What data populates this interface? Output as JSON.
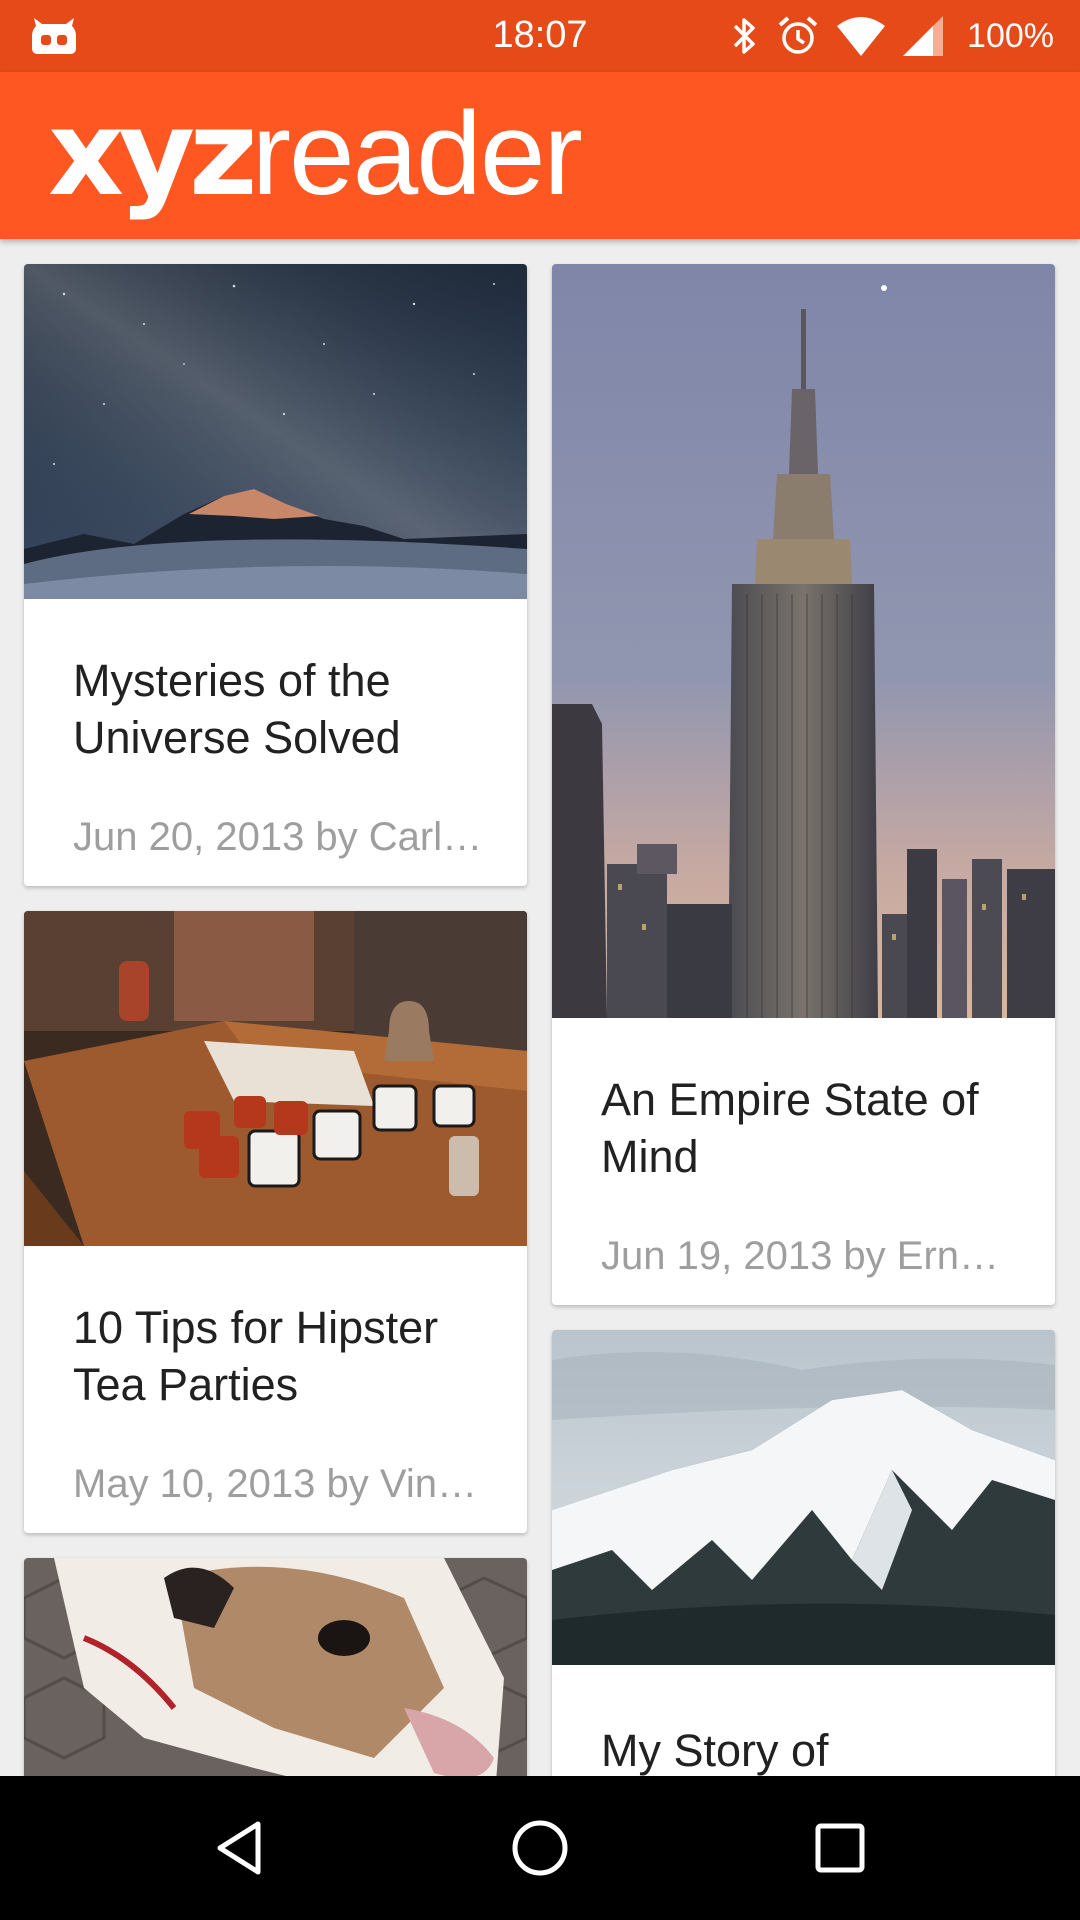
{
  "status_bar": {
    "time": "18:07",
    "battery": "100%",
    "icons": [
      "app-icon",
      "bluetooth-icon",
      "alarm-icon",
      "wifi-icon",
      "signal-icon"
    ]
  },
  "app_bar": {
    "logo_bold": "xyz",
    "logo_light": "reader",
    "background": "#ff5722"
  },
  "articles": [
    {
      "title": "Mysteries of the Universe Solved",
      "meta": "Jun 20, 2013 by Carl…",
      "image": "night-sky-mountains"
    },
    {
      "title": "An Empire State of Mind",
      "meta": "Jun 19, 2013 by Ern…",
      "image": "empire-state-building"
    },
    {
      "title": "10 Tips for Hipster Tea Parties",
      "meta": "May 10, 2013 by Vin…",
      "image": "tea-cups-table"
    },
    {
      "title": "My Story of",
      "meta": "",
      "image": "snowy-mountain"
    },
    {
      "title": "",
      "meta": "",
      "image": "bulldog"
    }
  ],
  "nav_bar": {
    "icons": [
      "back-icon",
      "home-icon",
      "recents-icon"
    ]
  }
}
